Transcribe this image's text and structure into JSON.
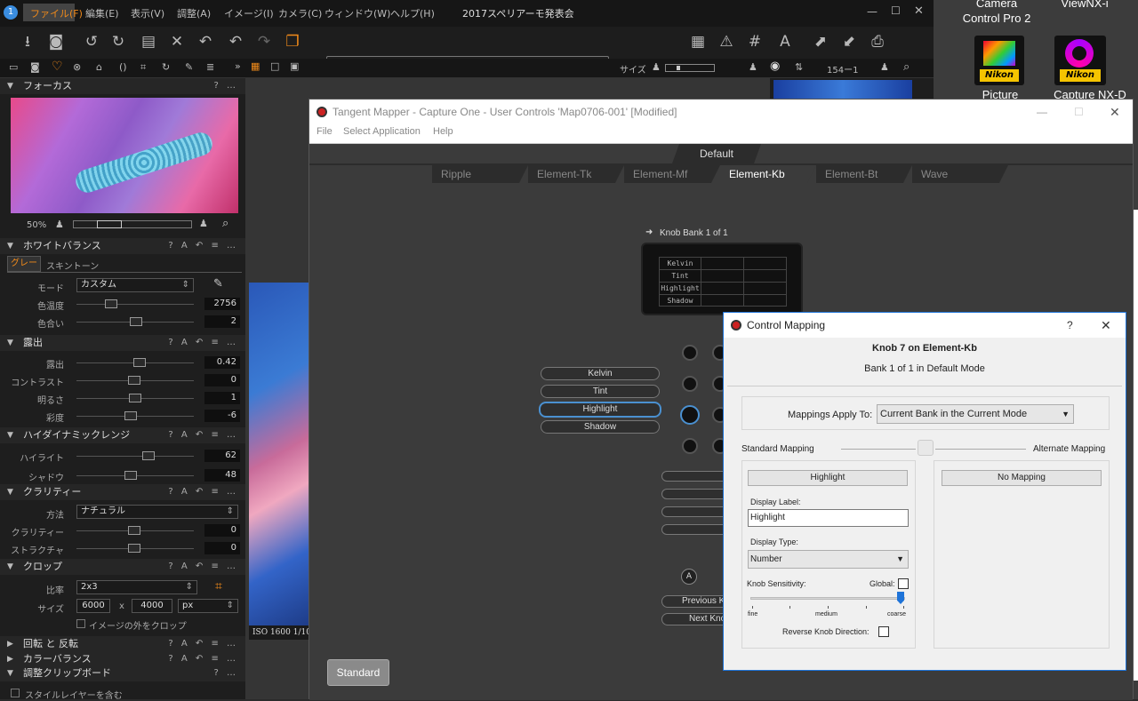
{
  "desktop": {
    "app1_label_line1": "Camera",
    "app1_label_line2": "Control Pro 2",
    "app2_label": "ViewNX-i",
    "icon1_brand": "Nikon",
    "icon1_label": "Picture",
    "icon2_brand": "Nikon",
    "icon2_label": "Capture NX-D"
  },
  "c1": {
    "menu": [
      "ファイル(F)",
      "編集(E)",
      "表示(V)",
      "調整(A)",
      "イメージ(I)",
      "カメラ(C)",
      "ウィンドウ(W)",
      "ヘルプ(H)"
    ],
    "title": "2017スペリアーモ発表会",
    "size_label": "サイズ",
    "counter": "154ー1",
    "zoom": "50%",
    "iso_text": "ISO 1600  1/10",
    "focus": {
      "title": "フォーカス"
    },
    "wb": {
      "title": "ホワイトバランス",
      "tab1": "グレー",
      "tab2": "スキントーン",
      "mode_label": "モード",
      "mode_value": "カスタム",
      "temp_label": "色温度",
      "temp_value": "2756",
      "tint_label": "色合い",
      "tint_value": "2"
    },
    "exposure": {
      "title": "露出",
      "exp_label": "露出",
      "exp_value": "0.42",
      "contrast_label": "コントラスト",
      "contrast_value": "0",
      "bright_label": "明るさ",
      "bright_value": "1",
      "sat_label": "彩度",
      "sat_value": "-6"
    },
    "hdr": {
      "title": "ハイダイナミックレンジ",
      "hl_label": "ハイライト",
      "hl_value": "62",
      "sh_label": "シャドウ",
      "sh_value": "48"
    },
    "clarity": {
      "title": "クラリティー",
      "method_label": "方法",
      "method_value": "ナチュラル",
      "clarity_label": "クラリティー",
      "clarity_value": "0",
      "struct_label": "ストラクチャ",
      "struct_value": "0"
    },
    "crop": {
      "title": "クロップ",
      "ratio_label": "比率",
      "ratio_value": "2x3",
      "size_label": "サイズ",
      "w": "6000",
      "x": "x",
      "h": "4000",
      "unit": "px",
      "outside_label": "イメージの外をクロップ"
    },
    "rotate": {
      "title": "回転 と 反転"
    },
    "colorbal": {
      "title": "カラーバランス"
    },
    "clipboard": {
      "title": "調整クリップボード",
      "style_label": "スタイルレイヤーを含む"
    }
  },
  "tangent": {
    "title": "Tangent Mapper - Capture One - User Controls 'Map0706-001' [Modified]",
    "menu": [
      "File",
      "Select Application",
      "Help"
    ],
    "mode_tab": "Default",
    "panel_tabs": [
      "Ripple",
      "Element-Tk",
      "Element-Mf",
      "Element-Kb",
      "Element-Bt",
      "Wave"
    ],
    "knob_bank": "Knob Bank 1 of 1",
    "lcd_rows": [
      "Kelvin",
      "Tint",
      "Highlight",
      "Shadow"
    ],
    "knob_labels": [
      "Kelvin",
      "Tint",
      "Highlight",
      "Shadow"
    ],
    "a_button": "A",
    "prev_button": "Previous K",
    "next_button": "Next Kno",
    "standard_button": "Standard"
  },
  "dialog": {
    "title": "Control Mapping",
    "help": "?",
    "close": "✕",
    "heading": "Knob 7 on Element-Kb",
    "subheading": "Bank 1 of 1 in Default Mode",
    "applies_label": "Mappings Apply To:",
    "applies_value": "Current Bank in the Current Mode",
    "standard_label": "Standard Mapping",
    "alternate_label": "Alternate Mapping",
    "standard_button": "Highlight",
    "alternate_button": "No Mapping",
    "display_label_caption": "Display Label:",
    "display_label_value": "Highlight",
    "display_type_caption": "Display Type:",
    "display_type_value": "Number",
    "sensitivity_caption": "Knob Sensitivity:",
    "global_caption": "Global:",
    "fine": "fine",
    "medium": "medium",
    "coarse": "coarse",
    "sensitivity_level": 1.0,
    "reverse_caption": "Reverse Knob Direction:"
  }
}
